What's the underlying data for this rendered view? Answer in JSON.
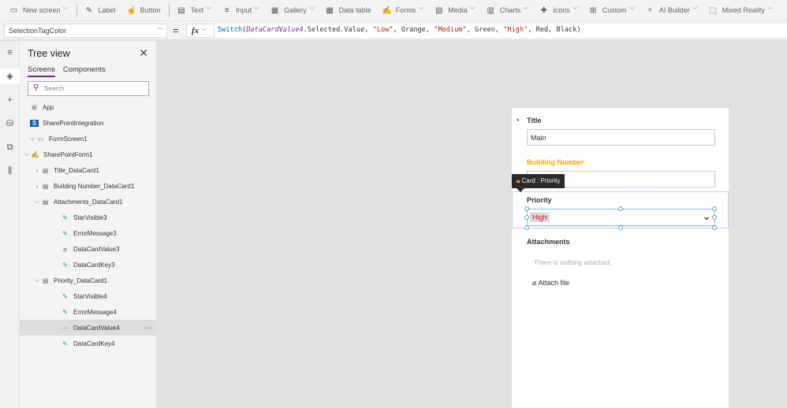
{
  "toolbar": {
    "items": [
      {
        "label": "New screen",
        "icon": "new-screen-icon",
        "glyph": "▭",
        "chev": true,
        "sep": true
      },
      {
        "label": "Label",
        "icon": "label-icon",
        "glyph": "✎",
        "chev": false
      },
      {
        "label": "Button",
        "icon": "button-icon",
        "glyph": "☝",
        "chev": false,
        "sep": true
      },
      {
        "label": "Text",
        "icon": "text-icon",
        "glyph": "▤",
        "chev": true
      },
      {
        "label": "Input",
        "icon": "input-icon",
        "glyph": "≡",
        "chev": true
      },
      {
        "label": "Gallery",
        "icon": "gallery-icon",
        "glyph": "▦",
        "chev": true
      },
      {
        "label": "Data table",
        "icon": "data-table-icon",
        "glyph": "▦",
        "chev": false
      },
      {
        "label": "Forms",
        "icon": "forms-icon",
        "glyph": "✍",
        "chev": true
      },
      {
        "label": "Media",
        "icon": "media-icon",
        "glyph": "▨",
        "chev": true
      },
      {
        "label": "Charts",
        "icon": "charts-icon",
        "glyph": "▥",
        "chev": true
      },
      {
        "label": "Icons",
        "icon": "icons-icon",
        "glyph": "✚",
        "chev": true
      },
      {
        "label": "Custom",
        "icon": "custom-icon",
        "glyph": "⊞",
        "chev": true
      },
      {
        "label": "AI Builder",
        "icon": "ai-builder-icon",
        "glyph": "⚬",
        "chev": true
      },
      {
        "label": "Mixed Reality",
        "icon": "mixed-reality-icon",
        "glyph": "⬚",
        "chev": true
      }
    ]
  },
  "formula_bar": {
    "property": "SelectionTagColor",
    "equals": "=",
    "fx": "fx",
    "formula": [
      {
        "t": "Switch",
        "c": "f-fn"
      },
      {
        "t": "(",
        "c": ""
      },
      {
        "t": "DataCardValue4",
        "c": "f-var"
      },
      {
        "t": ".Selected.Value, ",
        "c": ""
      },
      {
        "t": "\"Low\"",
        "c": "f-str"
      },
      {
        "t": ", Orange, ",
        "c": ""
      },
      {
        "t": "\"Medium\"",
        "c": "f-str"
      },
      {
        "t": ", Green, ",
        "c": ""
      },
      {
        "t": "\"High\"",
        "c": "f-str"
      },
      {
        "t": ", Red, Black)",
        "c": ""
      }
    ]
  },
  "rail": [
    "menu-icon",
    "layers-icon",
    "plus-icon",
    "database-icon",
    "media-icon",
    "tools-icon"
  ],
  "tree": {
    "title": "Tree view",
    "tabs": [
      "Screens",
      "Components"
    ],
    "search_placeholder": "Search",
    "items": [
      {
        "label": "App",
        "level": 0,
        "icon": "app-icon",
        "glyph": "⊞",
        "chev": ""
      },
      {
        "label": "SharePointIntegration",
        "level": 0,
        "icon": "sharepoint-icon",
        "glyph": "S",
        "chev": ""
      },
      {
        "label": "FormScreen1",
        "level": 0,
        "icon": "screen-icon",
        "glyph": "▭",
        "chev": "v"
      },
      {
        "label": "SharePointForm1",
        "level": 1,
        "icon": "form-icon",
        "glyph": "✍",
        "chev": "v"
      },
      {
        "label": "Title_DataCard1",
        "level": 2,
        "icon": "card-icon",
        "glyph": "▤",
        "chev": ">"
      },
      {
        "label": "Building Number_DataCard1",
        "level": 2,
        "icon": "card-icon",
        "glyph": "▤",
        "chev": ">"
      },
      {
        "label": "Attachments_DataCard1",
        "level": 2,
        "icon": "card-icon",
        "glyph": "▤",
        "chev": "v"
      },
      {
        "label": "StarVisible3",
        "level": 3,
        "icon": "edit-label-icon",
        "glyph": "✎",
        "chev": ""
      },
      {
        "label": "ErrorMessage3",
        "level": 3,
        "icon": "edit-label-icon",
        "glyph": "✎",
        "chev": ""
      },
      {
        "label": "DataCardValue3",
        "level": 3,
        "icon": "paperclip-icon",
        "glyph": "⌀",
        "chev": ""
      },
      {
        "label": "DataCardKey3",
        "level": 3,
        "icon": "edit-label-icon",
        "glyph": "✎",
        "chev": ""
      },
      {
        "label": "Priority_DataCard1",
        "level": 2,
        "icon": "card-icon",
        "glyph": "▤",
        "chev": "v"
      },
      {
        "label": "StarVisible4",
        "level": 3,
        "icon": "edit-label-icon",
        "glyph": "✎",
        "chev": ""
      },
      {
        "label": "ErrorMessage4",
        "level": 3,
        "icon": "edit-label-icon",
        "glyph": "✎",
        "chev": ""
      },
      {
        "label": "DataCardValue4",
        "level": 3,
        "icon": "dropdown-icon",
        "glyph": "⋯",
        "chev": "",
        "selected": true,
        "more": "···"
      },
      {
        "label": "DataCardKey4",
        "level": 3,
        "icon": "edit-label-icon",
        "glyph": "✎",
        "chev": ""
      }
    ]
  },
  "form": {
    "required_mark": "*",
    "title_label": "Title",
    "title_value": "Main",
    "building_label": "Building Number",
    "building_color": "#ffa500",
    "tooltip": "Card : Priority",
    "priority_label": "Priority",
    "priority_value": "High",
    "priority_color": "#e81123",
    "attachments_label": "Attachments",
    "nothing_attached": "There is nothing attached.",
    "attach_file": "Attach file"
  }
}
